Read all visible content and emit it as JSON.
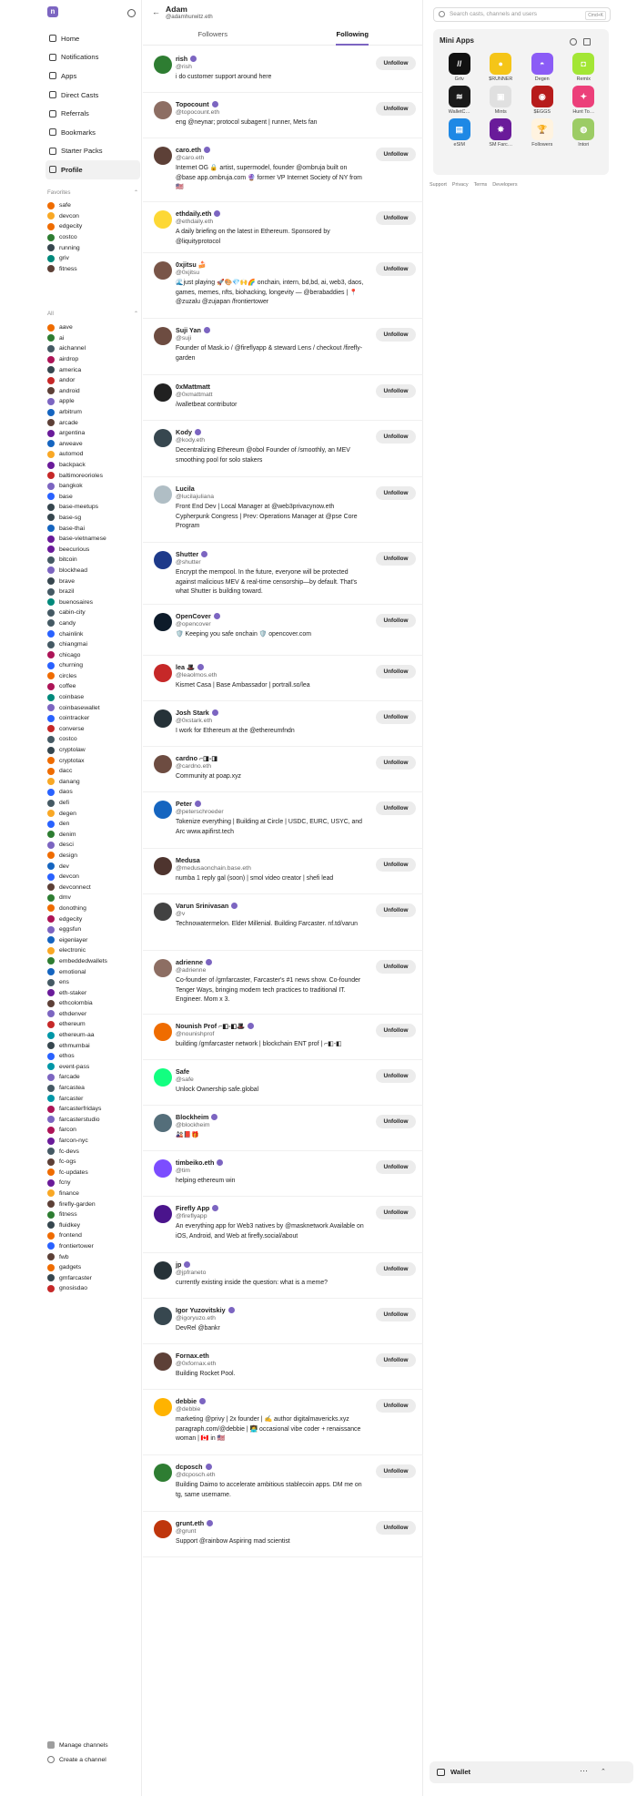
{
  "sidebar": {
    "nav": [
      {
        "label": "Home",
        "icon": "home-icon"
      },
      {
        "label": "Notifications",
        "icon": "bell-icon"
      },
      {
        "label": "Apps",
        "icon": "apps-icon"
      },
      {
        "label": "Direct Casts",
        "icon": "mail-icon"
      },
      {
        "label": "Referrals",
        "icon": "referral-icon"
      },
      {
        "label": "Bookmarks",
        "icon": "bookmark-icon"
      },
      {
        "label": "Starter Packs",
        "icon": "pack-icon"
      },
      {
        "label": "Profile",
        "icon": "profile-icon",
        "active": true
      }
    ],
    "favorites_label": "Favorites",
    "favorites": [
      "safe",
      "devcon",
      "edgecity",
      "costco",
      "running",
      "griv",
      "fitness"
    ],
    "all_label": "All",
    "all": [
      "aave",
      "ai",
      "aichannel",
      "airdrop",
      "america",
      "andor",
      "android",
      "apple",
      "arbitrum",
      "arcade",
      "argentina",
      "arweave",
      "automod",
      "backpack",
      "baltimoreorioles",
      "bangkok",
      "base",
      "base-meetups",
      "base-sg",
      "base-thai",
      "base-vietnamese",
      "beecurious",
      "bitcoin",
      "blockhead",
      "brave",
      "brazil",
      "buenosaires",
      "cabin-city",
      "candy",
      "chainlink",
      "chiangmai",
      "chicago",
      "churning",
      "circles",
      "coffee",
      "coinbase",
      "coinbasewallet",
      "cointracker",
      "converse",
      "costco",
      "cryptolaw",
      "cryptotax",
      "dacc",
      "danang",
      "daos",
      "defi",
      "degen",
      "den",
      "denim",
      "desci",
      "design",
      "dev",
      "devcon",
      "devconnect",
      "dmv",
      "donothing",
      "edgecity",
      "eggsfun",
      "eigenlayer",
      "electronic",
      "embeddedwallets",
      "emotional",
      "ens",
      "eth-staker",
      "ethcolombia",
      "ethdenver",
      "ethereum",
      "ethereum-aa",
      "ethmumbai",
      "ethos",
      "event-pass",
      "farcade",
      "farcastea",
      "farcaster",
      "farcasterfridays",
      "farcasterstudio",
      "farcon",
      "farcon-nyc",
      "fc-devs",
      "fc-ogs",
      "fc-updates",
      "fcny",
      "finance",
      "firefly-garden",
      "fitness",
      "fluidkey",
      "frontend",
      "frontiertower",
      "fwb",
      "gadgets",
      "gmfarcaster",
      "gnosisdao"
    ],
    "manage_channels": "Manage channels",
    "create_channel": "Create a channel"
  },
  "profile": {
    "name": "Adam",
    "handle": "@adamhurwitz.eth"
  },
  "tabs": {
    "followers": "Followers",
    "following": "Following"
  },
  "unfollow_label": "Unfollow",
  "following": [
    {
      "name": "rish",
      "handle": "@rish",
      "bio": "i do customer support around here",
      "verified": true,
      "color": "#2e7d32"
    },
    {
      "name": "Topocount",
      "handle": "@topocount.eth",
      "bio": "eng @neynar; protocol subagent | runner, Mets fan",
      "verified": true,
      "color": "#8d6e63"
    },
    {
      "name": "caro.eth",
      "handle": "@caro.eth",
      "bio": "Internet OG 🔒 artist, supermodel, founder @ombruja built on @base app.ombruja.com 🔮 former VP Internet Society of NY from 🇺🇸",
      "verified": true,
      "color": "#5d4037"
    },
    {
      "name": "ethdaily.eth",
      "handle": "@ethdaily.eth",
      "bio": "A daily briefing on the latest in Ethereum. Sponsored by @liquityprotocol",
      "verified": true,
      "color": "#fdd835"
    },
    {
      "name": "0xjitsu 🍰",
      "handle": "@0xjitsu",
      "bio": "🌊just playing 🚀🎨💎🙌🌈 onchain, intern, bd,bd, ai, web3, daos, games, memes, nfts, biohacking, longevity — @berabaddies | 📍 @zuzalu @zujapan /frontiertower",
      "verified": false,
      "color": "#795548"
    },
    {
      "name": "Suji Yan",
      "handle": "@suji",
      "bio": "Founder of Mask.io / @fireflyapp & steward Lens / checkout /firefly-garden",
      "verified": true,
      "color": "#6d4c41"
    },
    {
      "name": "0xMattmatt",
      "handle": "@0xmattmatt",
      "bio": "/walletbeat contributor",
      "verified": false,
      "color": "#212121"
    },
    {
      "name": "Kody",
      "handle": "@kody.eth",
      "bio": "Decentralizing Ethereum @obol Founder of /smoothly, an MEV smoothing pool for solo stakers",
      "verified": true,
      "color": "#37474f"
    },
    {
      "name": "Lucila",
      "handle": "@lucilajuliana",
      "bio": "Front End Dev | Local Manager at @web3privacynow.eth Cypherpunk Congress | Prev: Operations Manager at @pse Core Program",
      "verified": false,
      "color": "#b0bec5"
    },
    {
      "name": "Shutter",
      "handle": "@shutter",
      "bio": "Encrypt the mempool. In the future, everyone will be protected against malicious MEV & real-time censorship—by default. That's what Shutter is building toward.",
      "verified": true,
      "color": "#1e3a8a"
    },
    {
      "name": "OpenCover",
      "handle": "@opencover",
      "bio": "🛡️ Keeping you safe onchain 🛡️ opencover.com",
      "verified": true,
      "color": "#0d1b2a"
    },
    {
      "name": "lea 🎩",
      "handle": "@leaolmos.eth",
      "bio": "Kismet Casa | Base Ambassador | portrall.so/lea",
      "verified": true,
      "color": "#c62828"
    },
    {
      "name": "Josh Stark",
      "handle": "@0xstark.eth",
      "bio": "I work for Ethereum at the @ethereumfndn",
      "verified": true,
      "color": "#263238"
    },
    {
      "name": "cardno ⌐◨-◨",
      "handle": "@cardno.eth",
      "bio": "Community at poap.xyz",
      "verified": false,
      "color": "#6d4c41"
    },
    {
      "name": "Peter",
      "handle": "@peterschroeder",
      "bio": "Tokenize everything | Building at Circle | USDC, EURC, USYC, and Arc www.apifirst.tech",
      "verified": true,
      "color": "#1565c0"
    },
    {
      "name": "Medusa",
      "handle": "@medusaonchain.base.eth",
      "bio": "numba 1 reply gal (soon) | smol video creator | shefi lead",
      "verified": false,
      "color": "#4e342e"
    },
    {
      "name": "Varun Srinivasan",
      "handle": "@v",
      "bio": "Technowatermelon. Elder Millenial. Building Farcaster. nf.td/varun",
      "verified": true,
      "color": "#424242"
    },
    {
      "name": "adrienne",
      "handle": "@adrienne",
      "bio": "Co-founder of /gmfarcaster, Farcaster's #1 news show. Co-founder Tenger Ways, bringing modern tech practices to traditional IT. Engineer. Mom x 3.",
      "verified": true,
      "color": "#8d6e63"
    },
    {
      "name": "Nounish Prof ⌐◧-◧🎩",
      "handle": "@nounishprof",
      "bio": "building /gmfarcaster network | blockchain ENT prof | ⌐◧-◧",
      "verified": true,
      "color": "#ef6c00"
    },
    {
      "name": "Safe",
      "handle": "@safe",
      "bio": "Unlock Ownership safe.global",
      "verified": false,
      "color": "#12ff80"
    },
    {
      "name": "Blockheim",
      "handle": "@blockheim",
      "bio": "🎎📕🎁",
      "verified": true,
      "color": "#546e7a"
    },
    {
      "name": "timbeiko.eth",
      "handle": "@tim",
      "bio": "helping ethereum win",
      "verified": true,
      "color": "#7c4dff"
    },
    {
      "name": "Firefly App",
      "handle": "@fireflyapp",
      "bio": "An everything app for Web3 natives by @masknetwork Available on iOS, Android, and Web at firefly.social/about",
      "verified": true,
      "color": "#4a148c"
    },
    {
      "name": "jp",
      "handle": "@jpfraneto",
      "bio": "currently existing inside the question: what is a meme?",
      "verified": true,
      "color": "#263238"
    },
    {
      "name": "Igor Yuzovitskiy",
      "handle": "@igoryuzo.eth",
      "bio": "DevRel @bankr",
      "verified": true,
      "color": "#37474f"
    },
    {
      "name": "Fornax.eth",
      "handle": "@0xfornax.eth",
      "bio": "Building Rocket Pool.",
      "verified": false,
      "color": "#5d4037"
    },
    {
      "name": "debbie",
      "handle": "@debbie",
      "bio": "marketing @privy | 2x founder | ✍️ author digitalmavericks.xyz paragraph.com/@debbie | 👩‍💻 occasional vibe coder + renaissance woman | 🇨🇦 in 🇺🇸",
      "verified": true,
      "color": "#ffb300"
    },
    {
      "name": "dcposch",
      "handle": "@dcposch.eth",
      "bio": "Building Daimo to accelerate ambitious stablecoin apps. DM me on tg, same username.",
      "verified": true,
      "color": "#2e7d32"
    },
    {
      "name": "grunt.eth",
      "handle": "@grunt",
      "bio": "Support @rainbow Aspiring mad scientist",
      "verified": true,
      "color": "#bf360c"
    }
  ],
  "right": {
    "search_placeholder": "Search casts, channels and users",
    "search_kbd": "Cmd+K",
    "mini_apps_title": "Mini Apps",
    "apps": [
      {
        "label": "Grtv",
        "color": "#111111",
        "glyph": "//"
      },
      {
        "label": "$RUNNER",
        "color": "#f5c518",
        "glyph": "●"
      },
      {
        "label": "Degen",
        "color": "#8b5cf6",
        "glyph": "◓"
      },
      {
        "label": "Remix",
        "color": "#a3e635",
        "glyph": "◘"
      },
      {
        "label": "WalletC…",
        "color": "#1a1a1a",
        "glyph": "≋"
      },
      {
        "label": "Mints",
        "color": "#e0e0e0",
        "glyph": "▣"
      },
      {
        "label": "$EGGS",
        "color": "#b71c1c",
        "glyph": "◉"
      },
      {
        "label": "Hunt To…",
        "color": "#ec407a",
        "glyph": "✦"
      },
      {
        "label": "eSIM",
        "color": "#1e88e5",
        "glyph": "▤"
      },
      {
        "label": "SM Farc…",
        "color": "#6a1b9a",
        "glyph": "✸"
      },
      {
        "label": "Followers",
        "color": "#fff3e0",
        "glyph": "🏆"
      },
      {
        "label": "Intori",
        "color": "#9ccc65",
        "glyph": "◍"
      }
    ],
    "footer_links": [
      "Support",
      "Privacy",
      "Terms",
      "Developers"
    ],
    "wallet_label": "Wallet"
  }
}
